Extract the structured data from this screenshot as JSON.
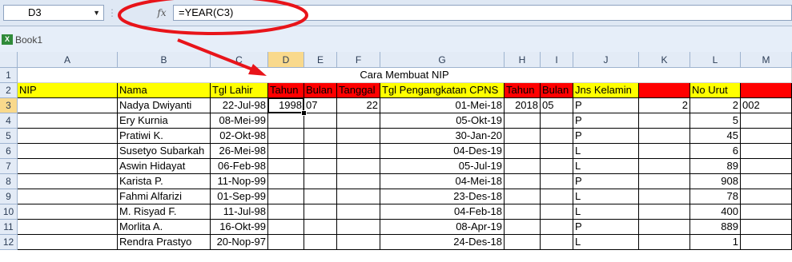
{
  "name_box": "D3",
  "formula": "=YEAR(C3)",
  "fx_label": "fx",
  "workbook": {
    "title": "Book1",
    "icon": "excel-workbook-icon"
  },
  "columns": [
    "A",
    "B",
    "C",
    "D",
    "E",
    "F",
    "G",
    "H",
    "I",
    "J",
    "K",
    "L",
    "M"
  ],
  "rows": [
    "1",
    "2",
    "3",
    "4",
    "5",
    "6",
    "7",
    "8",
    "9",
    "10",
    "11",
    "12"
  ],
  "selected": {
    "column": "D",
    "row": "3"
  },
  "sheet": {
    "title": "Cara Membuat NIP",
    "headers": {
      "A": "NIP",
      "B": "Nama",
      "C": "Tgl Lahir",
      "D": "Tahun",
      "E": "Bulan",
      "F": "Tanggal",
      "G": "Tgl Pengangkatan CPNS",
      "H": "Tahun",
      "I": "Bulan",
      "J": "Jns Kelamin",
      "K": "",
      "L": "No Urut",
      "M": ""
    },
    "records": [
      {
        "B": "Nadya Dwiyanti",
        "C": "22-Jul-98",
        "D": "1998",
        "E": "07",
        "F": "22",
        "G": "01-Mei-18",
        "H": "2018",
        "I": "05",
        "J": "P",
        "K": "2",
        "L": "2",
        "M": "002"
      },
      {
        "B": "Ery Kurnia",
        "C": "08-Mei-99",
        "D": "",
        "E": "",
        "F": "",
        "G": "05-Okt-19",
        "H": "",
        "I": "",
        "J": "P",
        "K": "",
        "L": "5",
        "M": ""
      },
      {
        "B": "Pratiwi K.",
        "C": "02-Okt-98",
        "D": "",
        "E": "",
        "F": "",
        "G": "30-Jan-20",
        "H": "",
        "I": "",
        "J": "P",
        "K": "",
        "L": "45",
        "M": ""
      },
      {
        "B": "Susetyo Subarkah",
        "C": "26-Mei-98",
        "D": "",
        "E": "",
        "F": "",
        "G": "04-Des-19",
        "H": "",
        "I": "",
        "J": "L",
        "K": "",
        "L": "6",
        "M": ""
      },
      {
        "B": "Aswin Hidayat",
        "C": "06-Feb-98",
        "D": "",
        "E": "",
        "F": "",
        "G": "05-Jul-19",
        "H": "",
        "I": "",
        "J": "L",
        "K": "",
        "L": "89",
        "M": ""
      },
      {
        "B": "Karista P.",
        "C": "11-Nop-99",
        "D": "",
        "E": "",
        "F": "",
        "G": "04-Mei-18",
        "H": "",
        "I": "",
        "J": "P",
        "K": "",
        "L": "908",
        "M": ""
      },
      {
        "B": "Fahmi Alfarizi",
        "C": "01-Sep-99",
        "D": "",
        "E": "",
        "F": "",
        "G": "23-Des-18",
        "H": "",
        "I": "",
        "J": "L",
        "K": "",
        "L": "78",
        "M": ""
      },
      {
        "B": "M. Risyad F.",
        "C": "11-Jul-98",
        "D": "",
        "E": "",
        "F": "",
        "G": "04-Feb-18",
        "H": "",
        "I": "",
        "J": "L",
        "K": "",
        "L": "400",
        "M": ""
      },
      {
        "B": "Morlita A.",
        "C": "16-Okt-99",
        "D": "",
        "E": "",
        "F": "",
        "G": "08-Apr-19",
        "H": "",
        "I": "",
        "J": "P",
        "K": "",
        "L": "889",
        "M": ""
      },
      {
        "B": "Rendra Prastyo",
        "C": "20-Nop-97",
        "D": "",
        "E": "",
        "F": "",
        "G": "24-Des-18",
        "H": "",
        "I": "",
        "J": "L",
        "K": "",
        "L": "1",
        "M": ""
      }
    ]
  },
  "colors": {
    "header_yellow": "#ffff00",
    "header_red": "#ff0000",
    "annotation_red": "#e8141a",
    "selection_header": "#f9d98c"
  }
}
